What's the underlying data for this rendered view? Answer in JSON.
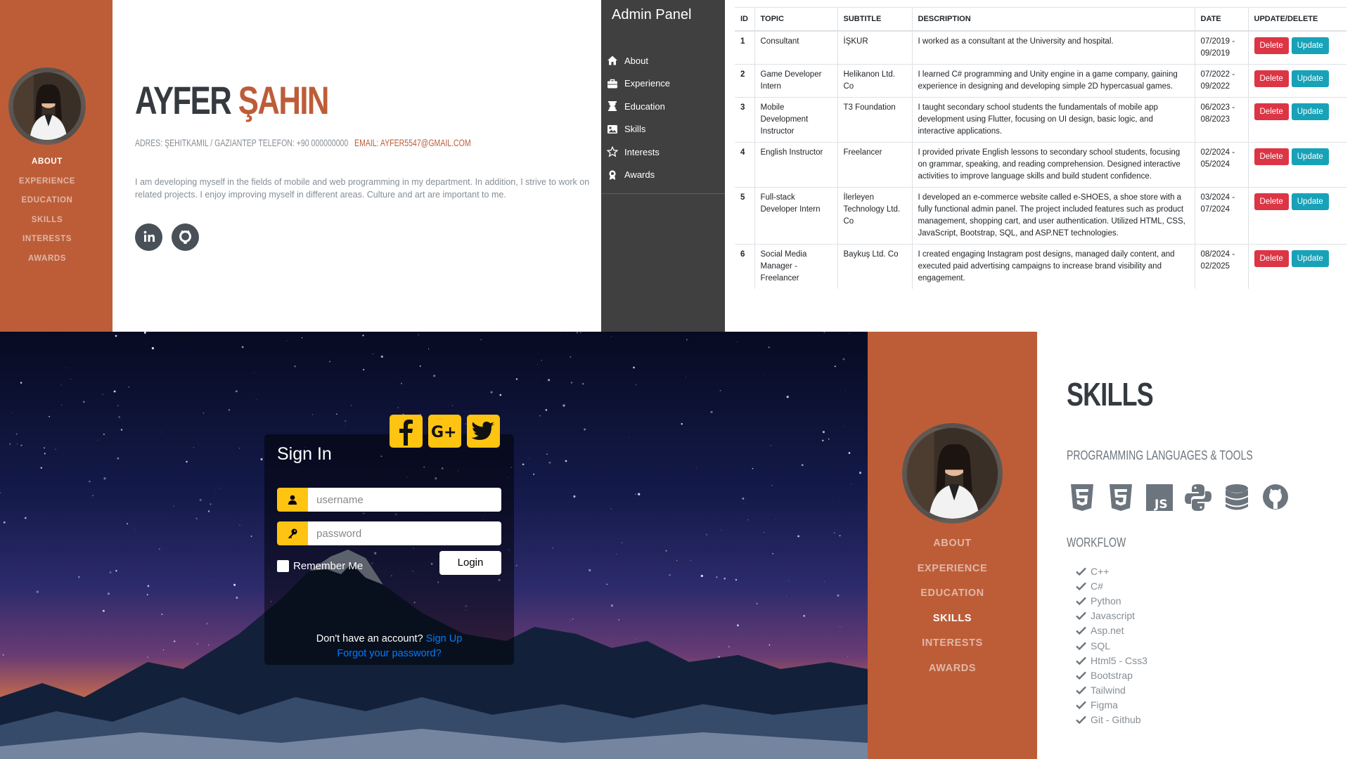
{
  "resume_about": {
    "nav": [
      "ABOUT",
      "EXPERIENCE",
      "EDUCATION",
      "SKILLS",
      "INTERESTS",
      "AWARDS"
    ],
    "active_nav": "ABOUT",
    "first_name": "AYFER",
    "last_name": "ŞAHIN",
    "address_line": "ADRES: ŞEHITKAMIL / GAZIANTEP   TELEFON: +90 000000000",
    "email_line": "EMAIL: AYFER5547@GMAIL.COM",
    "bio": "I am developing myself in the fields of mobile and web programming in my department. In addition, I strive to work on related projects. I enjoy improving myself in different areas. Culture and art are important to me.",
    "social_icons": [
      "linkedin-icon",
      "github-icon"
    ],
    "accent_color": "#bd5d38"
  },
  "admin_panel": {
    "title": "Admin Panel",
    "menu": [
      {
        "label": "About",
        "icon": "home-icon"
      },
      {
        "label": "Experience",
        "icon": "briefcase-icon"
      },
      {
        "label": "Education",
        "icon": "graduation-icon"
      },
      {
        "label": "Skills",
        "icon": "image-icon"
      },
      {
        "label": "Interests",
        "icon": "star-icon"
      },
      {
        "label": "Awards",
        "icon": "award-icon"
      }
    ],
    "table": {
      "headers": [
        "ID",
        "TOPIC",
        "SUBTITLE",
        "DESCRIPTION",
        "DATE",
        "UPDATE/DELETE"
      ],
      "delete_label": "Delete",
      "update_label": "Update",
      "rows": [
        {
          "id": "1",
          "topic": "Consultant",
          "subtitle": "İŞKUR",
          "description": "I worked as a consultant at the University and hospital.",
          "date": "07/2019 - 09/2019"
        },
        {
          "id": "2",
          "topic": "Game Developer Intern",
          "subtitle": "Helikanon Ltd. Co",
          "description": "I learned C# programming and Unity engine in a game company, gaining experience in designing and developing simple 2D hypercasual games.",
          "date": "07/2022 - 09/2022"
        },
        {
          "id": "3",
          "topic": "Mobile Development Instructor",
          "subtitle": "T3 Foundation",
          "description": "I taught secondary school students the fundamentals of mobile app development using Flutter, focusing on UI design, basic logic, and interactive applications.",
          "date": "06/2023 - 08/2023"
        },
        {
          "id": "4",
          "topic": "English Instructor",
          "subtitle": "Freelancer",
          "description": "I provided private English lessons to secondary school students, focusing on grammar, speaking, and reading comprehension. Designed interactive activities to improve language skills and build student confidence.",
          "date": "02/2024 - 05/2024"
        },
        {
          "id": "5",
          "topic": "Full-stack Developer Intern",
          "subtitle": "İlerleyen Technology Ltd. Co",
          "description": "I developed an e-commerce website called e-SHOES, a shoe store with a fully functional admin panel. The project included features such as product management, shopping cart, and user authentication. Utilized HTML, CSS, JavaScript, Bootstrap, SQL, and ASP.NET technologies.",
          "date": "03/2024 - 07/2024"
        },
        {
          "id": "6",
          "topic": "Social Media Manager - Freelancer",
          "subtitle": "Baykuş Ltd. Co",
          "description": "I created engaging Instagram post designs, managed daily content, and executed paid advertising campaigns to increase brand visibility and engagement.",
          "date": "08/2024 - 02/2025"
        }
      ]
    }
  },
  "login": {
    "title": "Sign In",
    "social_icons": [
      "facebook-icon",
      "google-plus-icon",
      "twitter-icon"
    ],
    "username_placeholder": "username",
    "password_placeholder": "password",
    "remember_label": "Remember Me",
    "login_button": "Login",
    "no_account_text": "Don't have an account?",
    "signup_link": "Sign Up",
    "forgot_link": "Forgot your password?",
    "accent_color": "#ffc312"
  },
  "skills": {
    "nav": [
      "ABOUT",
      "EXPERIENCE",
      "EDUCATION",
      "SKILLS",
      "INTERESTS",
      "AWARDS"
    ],
    "active_nav": "SKILLS",
    "title": "SKILLS",
    "languages_heading": "PROGRAMMING LANGUAGES & TOOLS",
    "tool_icons": [
      "html5-icon",
      "css3-icon",
      "javascript-icon",
      "python-icon",
      "database-icon",
      "github-icon"
    ],
    "workflow_heading": "WORKFLOW",
    "workflow": [
      "C++",
      "C#",
      "Python",
      "Javascript",
      "Asp.net",
      "SQL",
      "Html5 - Css3",
      "Bootstrap",
      "Tailwind",
      "Figma",
      "Git - Github"
    ]
  }
}
